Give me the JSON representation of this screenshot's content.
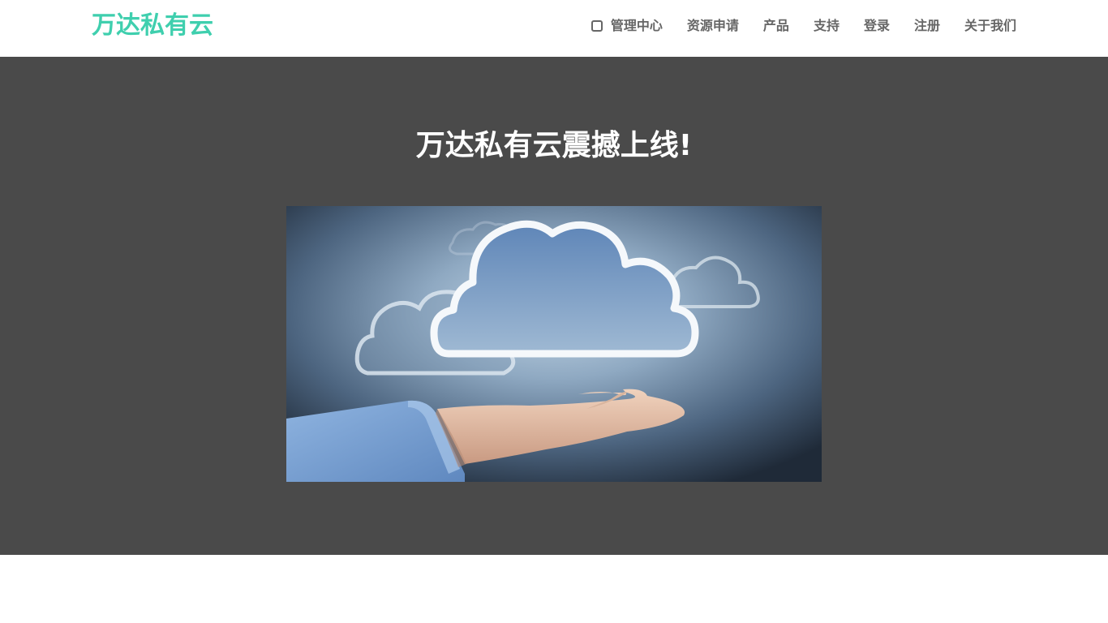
{
  "header": {
    "brand": "万达私有云",
    "nav": [
      {
        "label": "管理中心",
        "icon": "dashboard-icon"
      },
      {
        "label": "资源申请"
      },
      {
        "label": "产品"
      },
      {
        "label": "支持"
      },
      {
        "label": "登录"
      },
      {
        "label": "注册"
      },
      {
        "label": "关于我们"
      }
    ]
  },
  "hero": {
    "title": "万达私有云震撼上线!"
  },
  "colors": {
    "brand": "#3fcfae",
    "nav_text": "#666666",
    "hero_bg": "#4a4a4a",
    "hero_title": "#ffffff"
  }
}
